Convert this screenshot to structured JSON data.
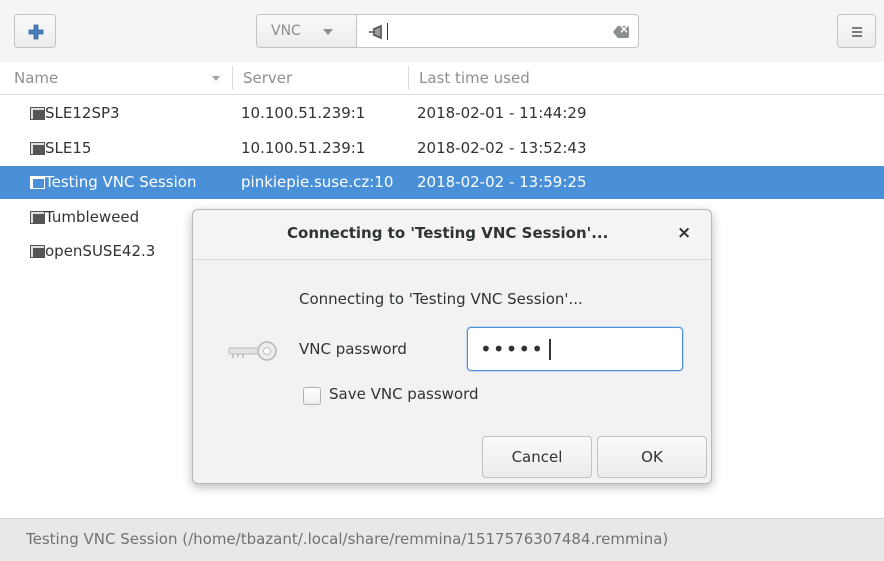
{
  "toolbar": {
    "protocol": "VNC",
    "quick_connect_value": "",
    "add_icon": "plus-icon",
    "menu_icon": "hamburger-icon"
  },
  "list": {
    "columns": [
      "Name",
      "Server",
      "Last time used"
    ],
    "rows": [
      {
        "name": "SLE12SP3",
        "server": "10.100.51.239:1",
        "last_used": "2018-02-01 - 11:44:29",
        "selected": false
      },
      {
        "name": "SLE15",
        "server": "10.100.51.239:1",
        "last_used": "2018-02-02 - 13:52:43",
        "selected": false
      },
      {
        "name": "Testing VNC Session",
        "server": "pinkiepie.suse.cz:10",
        "last_used": "2018-02-02 - 13:59:25",
        "selected": true
      },
      {
        "name": "Tumbleweed",
        "server": "",
        "last_used": "",
        "selected": false
      },
      {
        "name": "openSUSE42.3",
        "server": "",
        "last_used": "",
        "selected": false
      }
    ]
  },
  "status_bar": {
    "text": "Testing VNC Session (/home/tbazant/.local/share/remmina/1517576307484.remmina)"
  },
  "dialog": {
    "title": "Connecting to 'Testing VNC Session'...",
    "close": "×",
    "message": "Connecting to 'Testing VNC Session'...",
    "password_label": "VNC password",
    "password_value": "•••••",
    "save_label": "Save VNC password",
    "save_checked": false,
    "cancel": "Cancel",
    "ok": "OK",
    "key_icon": "key-icon"
  },
  "colors": {
    "selection": "#4a90d9",
    "background": "#f5f5f5"
  }
}
